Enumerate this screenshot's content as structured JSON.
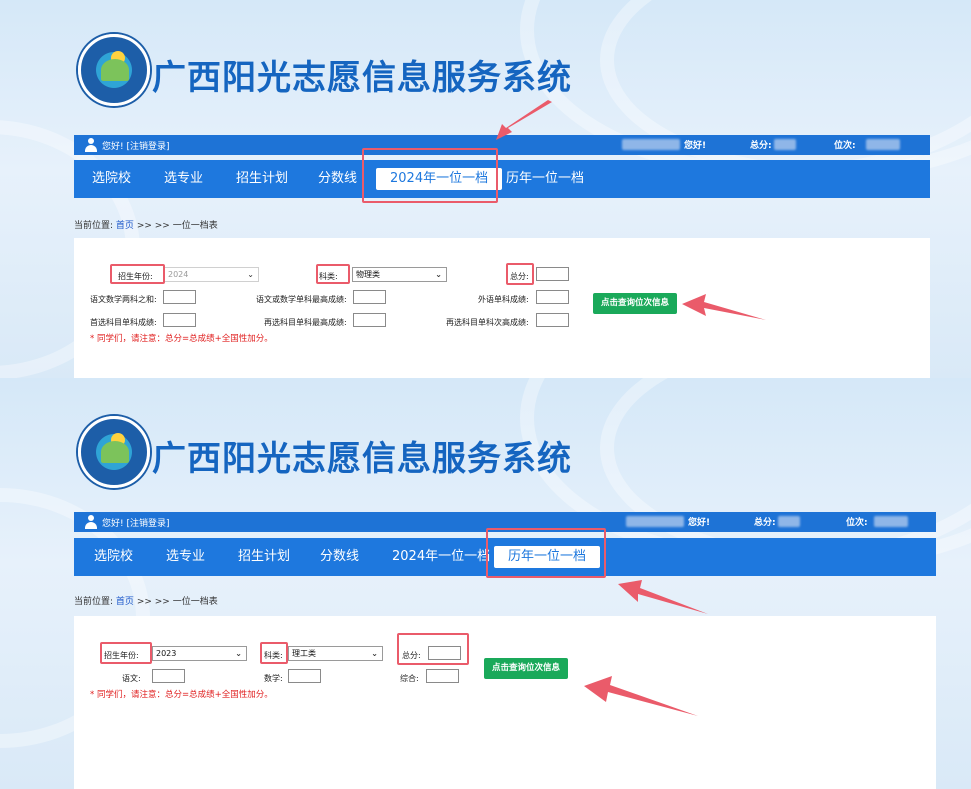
{
  "site": {
    "title": "广西阳光志愿信息服务系统"
  },
  "userbar": {
    "greeting": "您好! [注销登录]",
    "hello_right": "您好!",
    "score_label": "总分:",
    "rank_label": "位次:"
  },
  "breadcrumb": {
    "prefix": "当前位置:",
    "home": "首页",
    "rest": ">> >> 一位一档表"
  },
  "top": {
    "nav": [
      "选院校",
      "选专业",
      "招生计划",
      "分数线",
      "2024年一位一档",
      "历年一位一档"
    ],
    "active_index": 4,
    "form": {
      "year_label": "招生年份:",
      "year_value": "2024",
      "subject_label": "科类:",
      "subject_value": "物理类",
      "total_label": "总分:",
      "field1_label": "语文数学两科之和:",
      "field2_label": "语文或数学单科最高成绩:",
      "field3_label": "外语单科成绩:",
      "field4_label": "首选科目单科成绩:",
      "field5_label": "再选科目单科最高成绩:",
      "field6_label": "再选科目单科次高成绩:",
      "button": "点击查询位次信息",
      "note": "* 同学们，请注意：总分=总成绩+全国性加分。"
    }
  },
  "bottom": {
    "nav": [
      "选院校",
      "选专业",
      "招生计划",
      "分数线",
      "2024年一位一档",
      "历年一位一档"
    ],
    "active_index": 5,
    "form": {
      "year_label": "招生年份:",
      "year_value": "2023",
      "subject_label": "科类:",
      "subject_value": "理工类",
      "total_label": "总分:",
      "field1_label": "语文:",
      "field2_label": "数学:",
      "field3_label": "综合:",
      "button": "点击查询位次信息",
      "note": "* 同学们，请注意：总分=总成绩+全国性加分。"
    }
  },
  "colors": {
    "brand_blue": "#1e78de",
    "title_blue": "#1565c0",
    "button_green": "#1aa95a",
    "highlight_red": "#ea5b6a",
    "note_red": "#e02020"
  }
}
